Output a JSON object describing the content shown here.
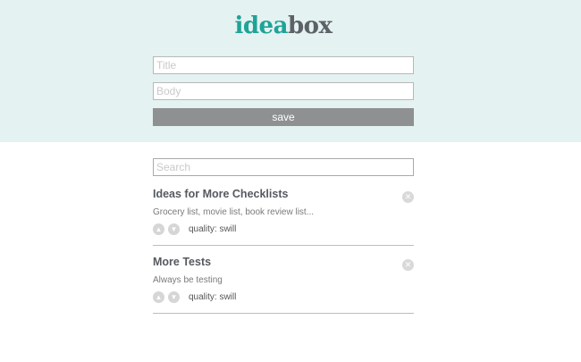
{
  "header": {
    "logo_part_a": "idea",
    "logo_part_b": "box"
  },
  "form": {
    "title_placeholder": "Title",
    "body_placeholder": "Body",
    "save_label": "save"
  },
  "search": {
    "placeholder": "Search"
  },
  "ideas": [
    {
      "title": "Ideas for More Checklists",
      "body": "Grocery list, movie list, book review list...",
      "quality": "quality: swill"
    },
    {
      "title": "More Tests",
      "body": "Always be testing",
      "quality": "quality: swill"
    }
  ],
  "icons": {
    "delete": "close-icon",
    "upvote": "arrow-up-icon",
    "downvote": "arrow-down-icon"
  },
  "colors": {
    "header_bg": "#e4f2f1",
    "logo_accent": "#1fa397",
    "logo_dark": "#5d6168",
    "save_button": "#8e9092"
  }
}
